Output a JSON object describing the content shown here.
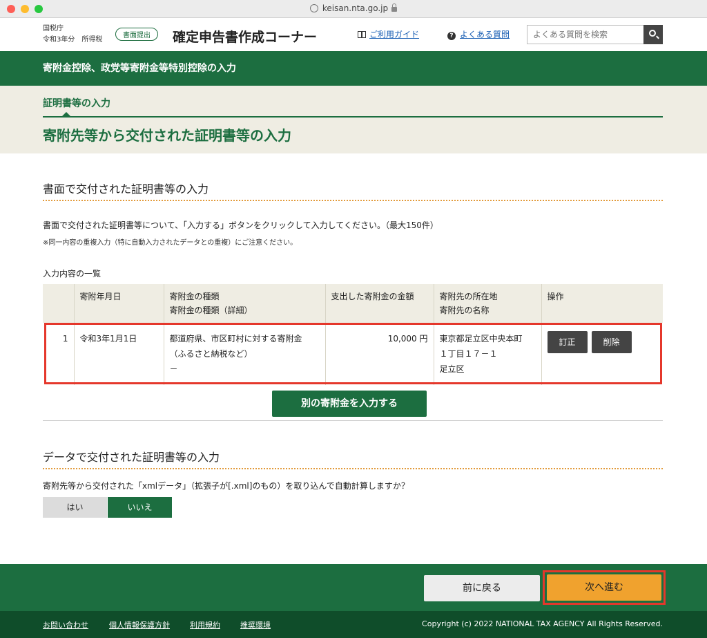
{
  "browser": {
    "url": "keisan.nta.go.jp"
  },
  "header": {
    "org_line1": "国税庁",
    "org_line2": "令和3年分　所得税",
    "badge": "書面提出",
    "app_title": "確定申告書作成コーナー",
    "guide_link": "ご利用ガイド",
    "faq_link": "よくある質問",
    "search_placeholder": "よくある質問を検索"
  },
  "section_bar": {
    "title": "寄附金控除、政党等寄附金等特別控除の入力"
  },
  "step": {
    "subtitle": "証明書等の入力",
    "title": "寄附先等から交付された証明書等の入力"
  },
  "paper_section": {
    "title": "書面で交付された証明書等の入力",
    "instruction": "書面で交付された証明書等について、「入力する」ボタンをクリックして入力してください。（最大150件）",
    "note": "※同一内容の重複入力（特に自動入力されたデータとの重複）にご注意ください。",
    "list_label": "入力内容の一覧",
    "columns": {
      "date": "寄附年月日",
      "kind": "寄附金の種類",
      "kind_detail": "寄附金の種類（詳細）",
      "amount": "支出した寄附金の金額",
      "location": "寄附先の所在地",
      "name": "寄附先の名称",
      "ops": "操作"
    },
    "rows": [
      {
        "no": "1",
        "date": "令和3年1月1日",
        "kind": "都道府県、市区町村に対する寄附金",
        "kind_sub": "（ふるさと納税など）",
        "kind_detail": "－",
        "amount": "10,000 円",
        "location_1": "東京都足立区中央本町",
        "location_2": "１丁目１７－１",
        "name": "足立区",
        "edit_label": "訂正",
        "delete_label": "削除"
      }
    ],
    "add_button": "別の寄附金を入力する"
  },
  "data_section": {
    "title": "データで交付された証明書等の入力",
    "question": "寄附先等から交付された「xmlデータ」（拡張子が[.xml]のもの）を取り込んで自動計算しますか？",
    "yes_label": "はい",
    "no_label": "いいえ",
    "selected": "いいえ"
  },
  "footer": {
    "back_label": "前に戻る",
    "next_label": "次へ進む",
    "links": [
      "お問い合わせ",
      "個人情報保護方針",
      "利用規約",
      "推奨環境"
    ],
    "copyright": "Copyright (c) 2022 NATIONAL TAX AGENCY All Rights Reserved."
  },
  "colors": {
    "brand_green": "#1c6e40",
    "dark_green": "#0f4d2a",
    "highlight_red": "#e5372b",
    "next_orange": "#f0a22e",
    "beige": "#efede3"
  }
}
